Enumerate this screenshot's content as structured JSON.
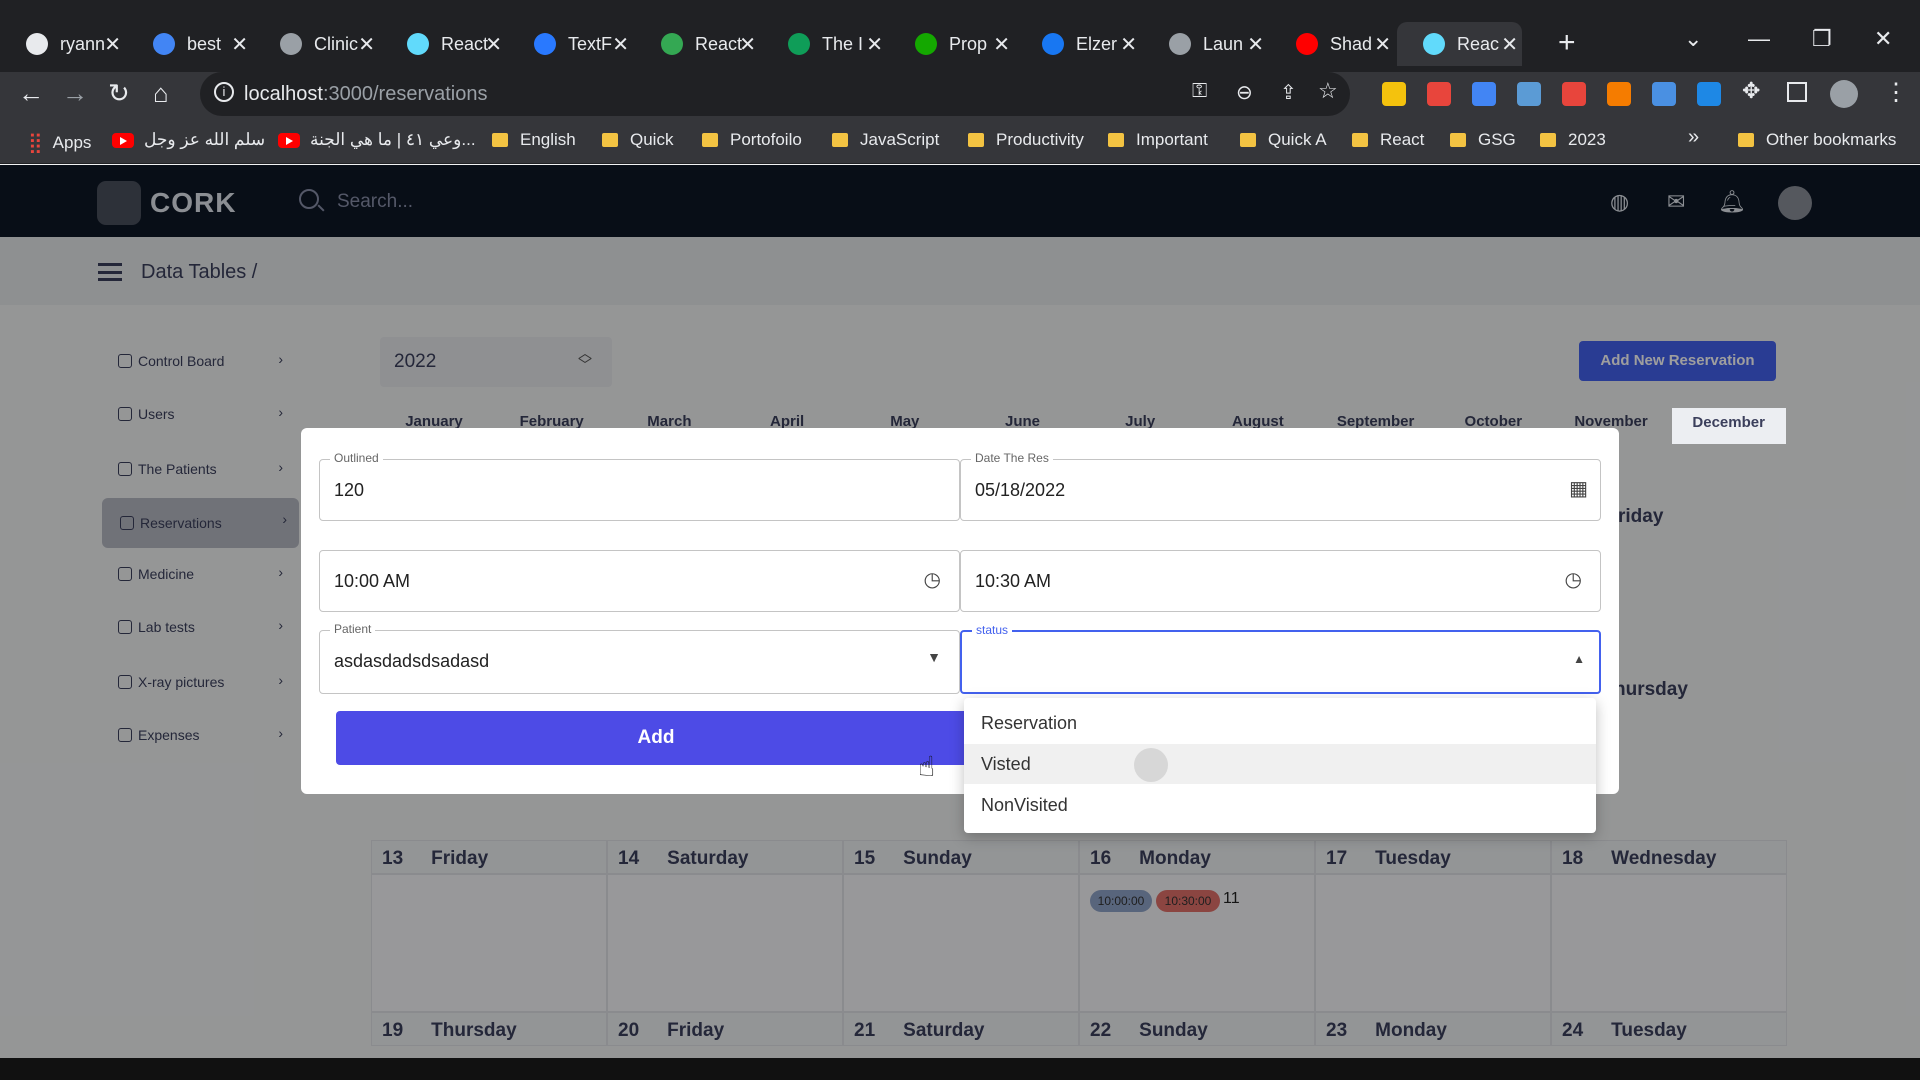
{
  "tabs": [
    {
      "title": "ryann",
      "color": "#e8eaed"
    },
    {
      "title": "best",
      "color": "#4285f4"
    },
    {
      "title": "Clinic",
      "color": "#9aa0a6"
    },
    {
      "title": "React",
      "color": "#61dafb"
    },
    {
      "title": "TextF",
      "color": "#2979ff"
    },
    {
      "title": "React",
      "color": "#34a853"
    },
    {
      "title": "The I",
      "color": "#0f9d58"
    },
    {
      "title": "Prop",
      "color": "#14a800"
    },
    {
      "title": "Elzer",
      "color": "#1877f2"
    },
    {
      "title": "Laun",
      "color": "#9aa0a6"
    },
    {
      "title": "Shad",
      "color": "#ff0000"
    },
    {
      "title": "Reac",
      "color": "#61dafb"
    }
  ],
  "address": {
    "host": "localhost",
    "path": ":3000/reservations"
  },
  "bookmarks": [
    {
      "label": "Apps",
      "type": "apps"
    },
    {
      "label": "سلم الله عز وجل",
      "type": "yt"
    },
    {
      "label": "وعي ٤١ | ما هي الجنة...",
      "type": "yt"
    },
    {
      "label": "English",
      "type": "folder"
    },
    {
      "label": "Quick",
      "type": "folder"
    },
    {
      "label": "Portofoilo",
      "type": "folder"
    },
    {
      "label": "JavaScript",
      "type": "folder"
    },
    {
      "label": "Productivity",
      "type": "folder"
    },
    {
      "label": "Important",
      "type": "folder"
    },
    {
      "label": "Quick A",
      "type": "folder"
    },
    {
      "label": "React",
      "type": "folder"
    },
    {
      "label": "GSG",
      "type": "folder"
    },
    {
      "label": "2023",
      "type": "folder"
    }
  ],
  "bookmarks_more": "»",
  "other_bookmarks": "Other bookmarks",
  "app": {
    "brand": "CORK",
    "search_placeholder": "Search..."
  },
  "breadcrumb": "Data Tables /",
  "sidebar": [
    {
      "label": "Control Board",
      "active": false
    },
    {
      "label": "Users",
      "active": false
    },
    {
      "label": "The Patients",
      "active": false
    },
    {
      "label": "Reservations",
      "active": true
    },
    {
      "label": "Medicine",
      "active": false
    },
    {
      "label": "Lab tests",
      "active": false
    },
    {
      "label": "X-ray pictures",
      "active": false
    },
    {
      "label": "Expenses",
      "active": false
    }
  ],
  "year": "2022",
  "add_reservation_label": "Add New Reservation",
  "months": [
    "January",
    "February",
    "March",
    "April",
    "May",
    "June",
    "July",
    "August",
    "September",
    "October",
    "November",
    "December"
  ],
  "calendar_ghost": {
    "fri": "riday",
    "thu": "hursday"
  },
  "calendar": {
    "week1": [
      {
        "day": "13",
        "name": "Friday"
      },
      {
        "day": "14",
        "name": "Saturday"
      },
      {
        "day": "15",
        "name": "Sunday"
      },
      {
        "day": "16",
        "name": "Monday"
      },
      {
        "day": "17",
        "name": "Tuesday"
      },
      {
        "day": "18",
        "name": "Wednesday"
      }
    ],
    "week2": [
      {
        "day": "19",
        "name": "Thursday"
      },
      {
        "day": "20",
        "name": "Friday"
      },
      {
        "day": "21",
        "name": "Saturday"
      },
      {
        "day": "22",
        "name": "Sunday"
      },
      {
        "day": "23",
        "name": "Monday"
      },
      {
        "day": "24",
        "name": "Tuesday"
      }
    ],
    "event": {
      "start": "10:00:00",
      "end": "10:30:00",
      "patient": "11"
    }
  },
  "form": {
    "outlined_label": "Outlined",
    "outlined_value": "120",
    "date_label": "Date The Res",
    "date_value": "05/18/2022",
    "start_time": "10:00 AM",
    "end_time": "10:30 AM",
    "patient_label": "Patient",
    "patient_value": "asdasdadsdsadasd",
    "status_label": "status",
    "status_value": "",
    "add_label": "Add"
  },
  "status_options": [
    {
      "label": "Reservation",
      "highlighted": false
    },
    {
      "label": "Visted",
      "highlighted": true
    },
    {
      "label": "NonVisited",
      "highlighted": false
    }
  ],
  "colors": {
    "accent": "#4361ee",
    "header": "#0e1726",
    "chip_start": "#8fa3c9",
    "chip_end": "#e0706a"
  }
}
